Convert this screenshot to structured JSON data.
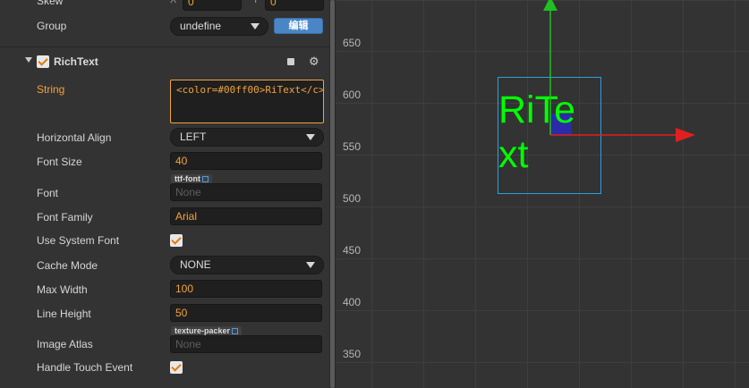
{
  "inspector": {
    "skew": {
      "label": "Skew",
      "x_label": "X",
      "x_value": "0",
      "y_label": "Y",
      "y_value": "0"
    },
    "group": {
      "label": "Group",
      "value": "undefine",
      "edit_button": "编辑"
    },
    "component": {
      "title": "RichText",
      "enabled": true,
      "book_icon": "book-icon",
      "gear_icon": "gear-icon"
    },
    "string": {
      "label": "String",
      "value": "<color=#00ff00>RiText</c>"
    },
    "horizontal_align": {
      "label": "Horizontal Align",
      "value": "LEFT"
    },
    "font_size": {
      "label": "Font Size",
      "value": "40"
    },
    "font": {
      "label": "Font",
      "tag": "ttf-font",
      "value": "None"
    },
    "font_family": {
      "label": "Font Family",
      "value": "Arial"
    },
    "use_system_font": {
      "label": "Use System Font",
      "checked": true
    },
    "cache_mode": {
      "label": "Cache Mode",
      "value": "NONE"
    },
    "max_width": {
      "label": "Max Width",
      "value": "100"
    },
    "line_height": {
      "label": "Line Height",
      "value": "50"
    },
    "image_atlas": {
      "label": "Image Atlas",
      "tag": "texture-packer",
      "value": "None"
    },
    "handle_touch_event": {
      "label": "Handle Touch Event",
      "checked": true
    }
  },
  "scene": {
    "y_axis_labels": [
      "650",
      "600",
      "550",
      "500",
      "450",
      "400",
      "350"
    ],
    "rich_text_line1": "RiTe",
    "rich_text_line2": "xt",
    "colors": {
      "text": "#00ff00",
      "x_gizmo": "#e02020",
      "y_gizmo": "#20c020",
      "selection": "#2aa0e0",
      "accent": "#f1a33a"
    }
  }
}
